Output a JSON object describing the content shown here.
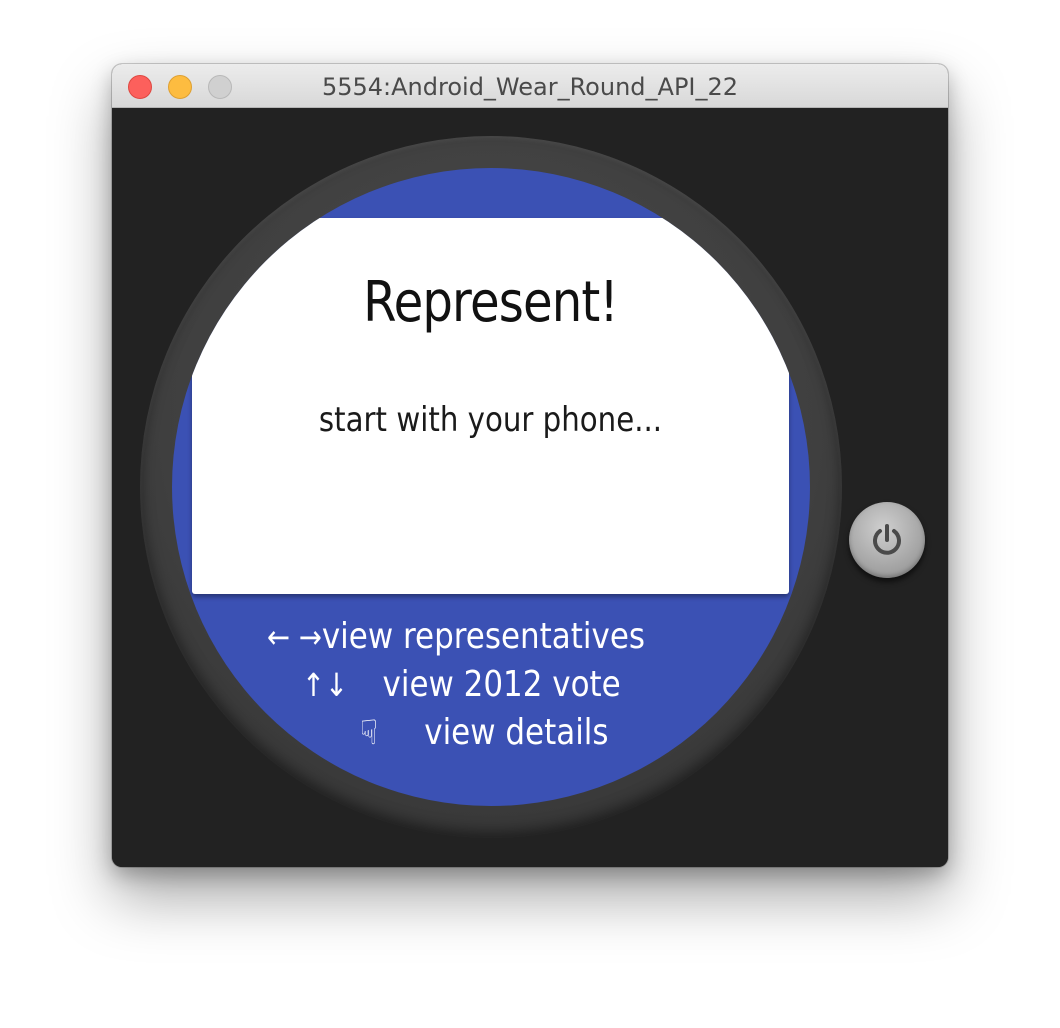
{
  "window": {
    "title": "5554:Android_Wear_Round_API_22"
  },
  "card": {
    "title": "Represent!",
    "subtitle": "start with your phone..."
  },
  "hints": [
    {
      "glyph": "← →",
      "label": "view representatives"
    },
    {
      "glyph": "↑↓",
      "label": "view 2012 vote"
    },
    {
      "glyph": "☟",
      "label": "view details"
    }
  ],
  "icons": {
    "power": "power-icon"
  },
  "colors": {
    "screen_background": "#3b51b4",
    "card_background": "#ffffff",
    "bezel": "#444444",
    "window_background": "#222222"
  }
}
